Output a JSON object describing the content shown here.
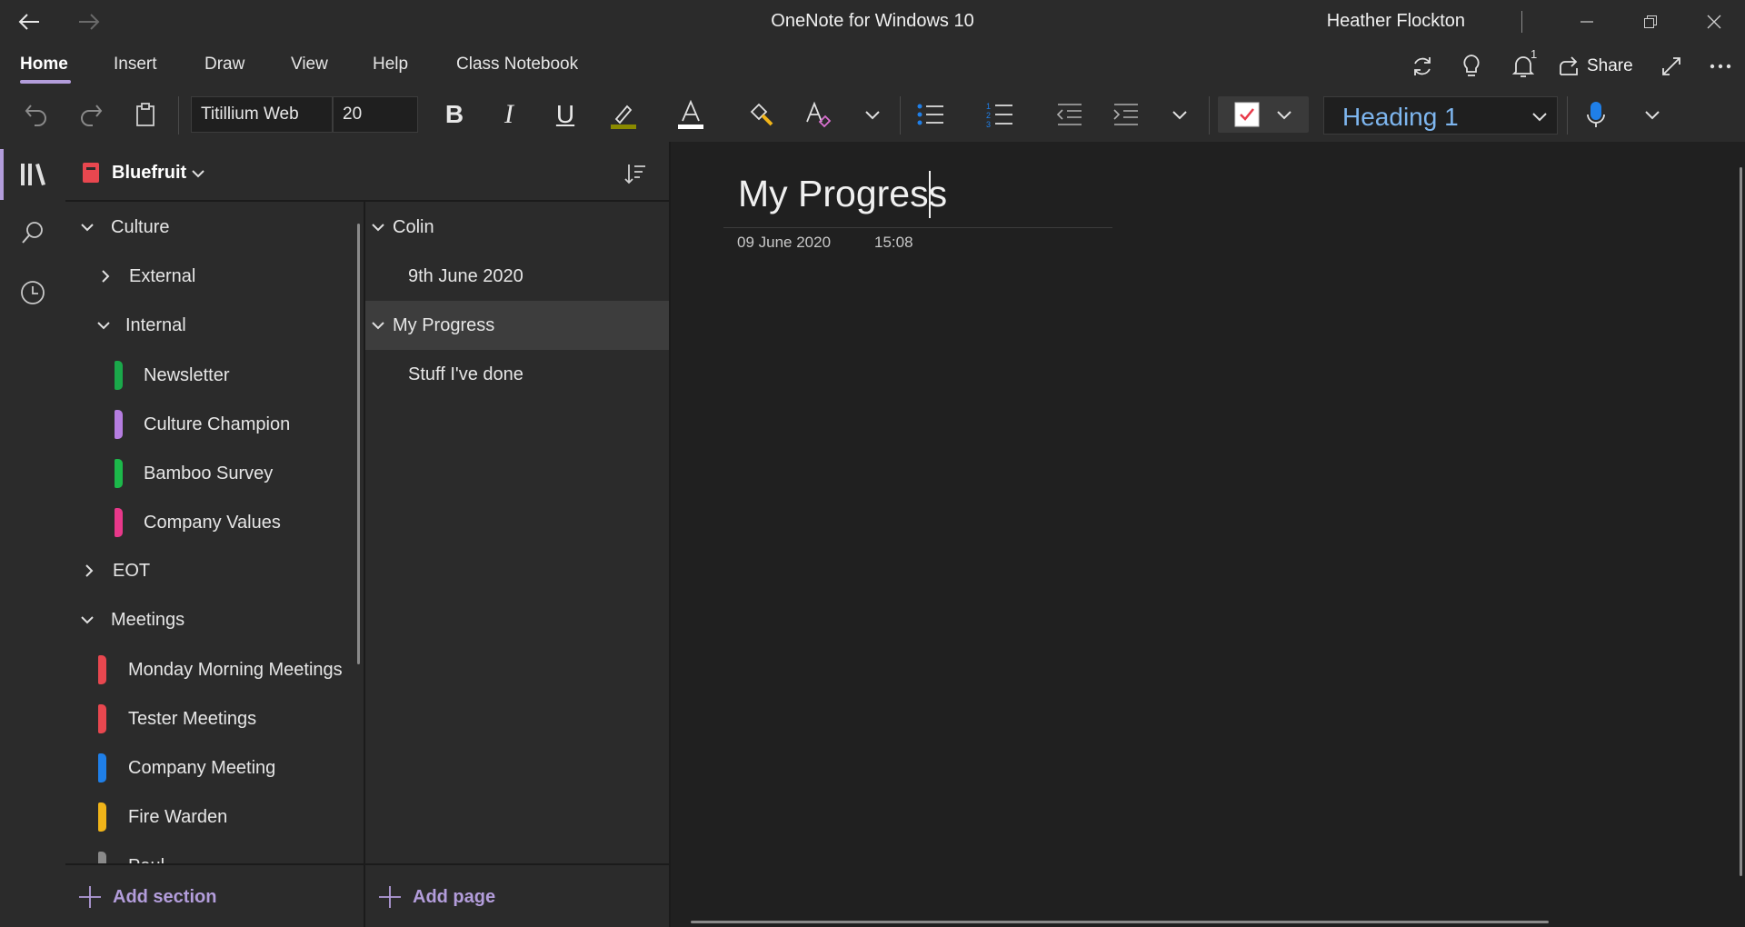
{
  "window": {
    "title": "OneNote for Windows 10",
    "user": "Heather Flockton"
  },
  "ribbon": {
    "tabs": [
      "Home",
      "Insert",
      "Draw",
      "View",
      "Help",
      "Class Notebook"
    ],
    "active_tab": "Home",
    "share_label": "Share",
    "notification_count": "1"
  },
  "toolbar": {
    "font_name": "Titillium Web",
    "font_size": "20",
    "style": "Heading 1",
    "colors": {
      "highlight": "#8a8a00",
      "font_color": "#ffffff",
      "todo_check": "#e83a4a",
      "accent": "#b39ddb",
      "style_text": "#7eb6ef"
    }
  },
  "notebook": {
    "name": "Bluefruit",
    "sections": [
      {
        "label": "Culture",
        "type": "group",
        "expanded": true
      },
      {
        "label": "External",
        "type": "group",
        "expanded": false
      },
      {
        "label": "Internal",
        "type": "group",
        "expanded": true
      },
      {
        "label": "Newsletter",
        "type": "section",
        "color": "#1aa84a"
      },
      {
        "label": "Culture Champion",
        "type": "section",
        "color": "#b57de0"
      },
      {
        "label": "Bamboo Survey",
        "type": "section",
        "color": "#1cb84a"
      },
      {
        "label": "Company Values",
        "type": "section",
        "color": "#e8388a"
      },
      {
        "label": "EOT",
        "type": "group",
        "expanded": false
      },
      {
        "label": "Meetings",
        "type": "group",
        "expanded": true
      },
      {
        "label": "Monday Morning Meetings",
        "type": "section",
        "color": "#e8474f"
      },
      {
        "label": "Tester Meetings",
        "type": "section",
        "color": "#e8474f"
      },
      {
        "label": "Company Meeting",
        "type": "section",
        "color": "#1f7fe8"
      },
      {
        "label": "Fire Warden",
        "type": "section",
        "color": "#f0b419"
      },
      {
        "label": "Paul",
        "type": "section",
        "color": "#8a8a8a"
      }
    ],
    "add_section_label": "Add section"
  },
  "pages": {
    "items": [
      {
        "label": "Colin",
        "expanded": true
      },
      {
        "label": "9th June 2020"
      },
      {
        "label": "My Progress",
        "expanded": true,
        "selected": true
      },
      {
        "label": "Stuff I've done"
      }
    ],
    "add_page_label": "Add page"
  },
  "page": {
    "title": "My Progress",
    "date": "09 June 2020",
    "time": "15:08"
  }
}
